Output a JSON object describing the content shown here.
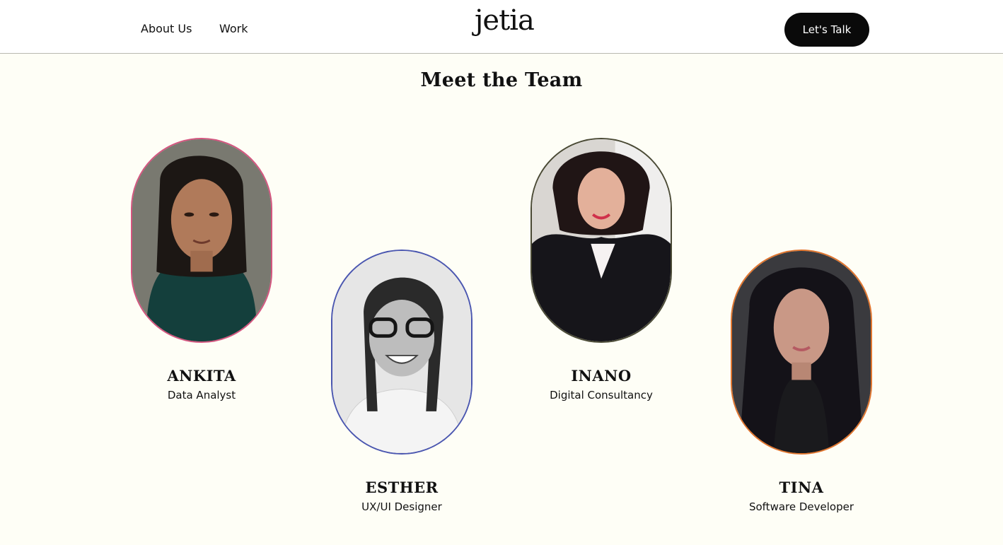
{
  "header": {
    "nav": [
      {
        "label": "About Us"
      },
      {
        "label": "Work"
      }
    ],
    "logo_text": "jetia",
    "cta_label": "Let's Talk"
  },
  "section": {
    "title": "Meet the Team"
  },
  "team": [
    {
      "name": "ANKITA",
      "role": "Data Analyst",
      "border_color": "#d4557f",
      "photo": "portrait-photo"
    },
    {
      "name": "ESTHER",
      "role": "UX/UI Designer",
      "border_color": "#4a56b0",
      "photo": "portrait-photo-grayscale"
    },
    {
      "name": "INANO",
      "role": "Digital Consultancy",
      "border_color": "#4a4a35",
      "photo": "portrait-photo"
    },
    {
      "name": "TINA",
      "role": "Software Developer",
      "border_color": "#e0752e",
      "photo": "portrait-photo"
    }
  ]
}
